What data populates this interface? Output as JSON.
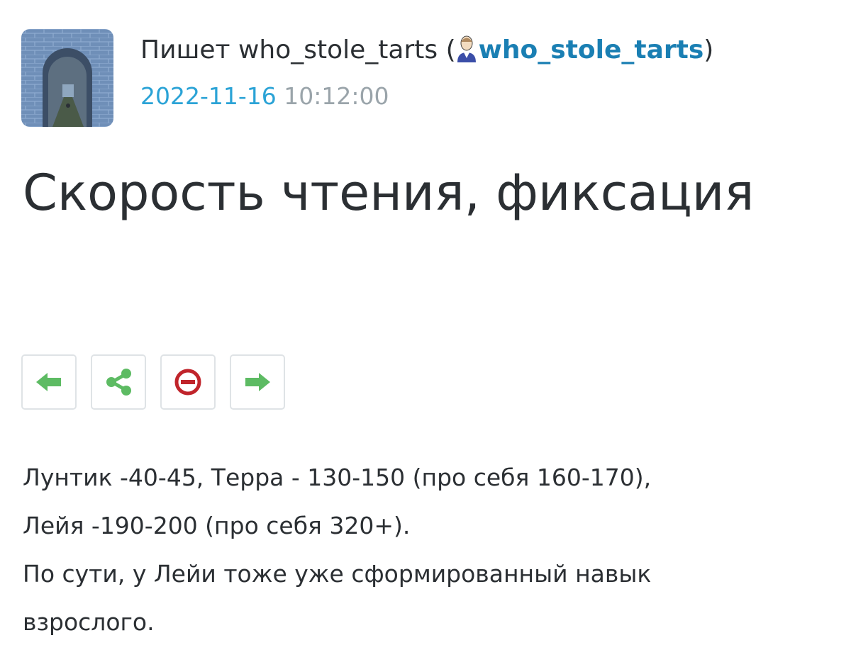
{
  "post": {
    "author_prefix": "Пишет who_stole_tarts (",
    "author_username": "who_stole_tarts",
    "author_suffix": ")",
    "date": "2022-11-16",
    "time": "10:12:00",
    "title": "Скорость чтения, фиксация",
    "body_lines": [
      "Лунтик -40-45, Терра - 130-150 (про себя 160-170),",
      "Лейя -190-200 (про себя 320+).",
      "По сути, у Лейи тоже уже сформированный навык",
      "взрослого."
    ]
  },
  "icons": {
    "avatar": "stone-archway-photo",
    "user": "user-icon",
    "prev": "arrow-left-icon",
    "share": "share-icon",
    "block": "no-entry-icon",
    "next": "arrow-right-icon"
  },
  "colors": {
    "link": "#1a7fb3",
    "date": "#2ba3d6",
    "time": "#9aa4aa",
    "action_green": "#5dbb63",
    "block_red": "#c0242b",
    "text": "#2b2f33"
  }
}
